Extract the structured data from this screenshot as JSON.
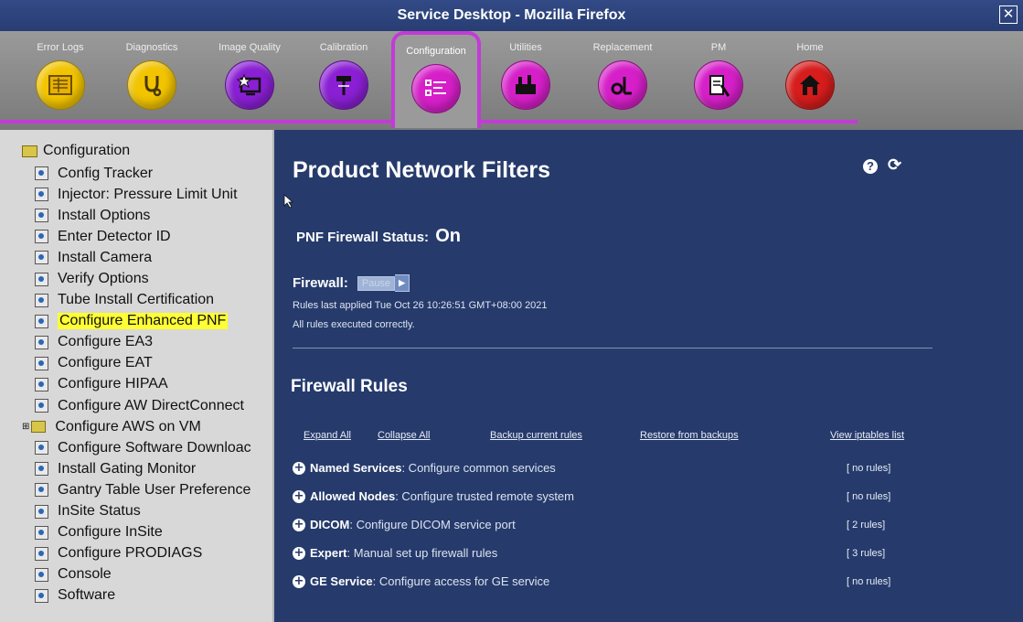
{
  "window": {
    "title": "Service Desktop - Mozilla Firefox",
    "close": "✕"
  },
  "toolbar": {
    "tabs": [
      {
        "label": "Error Logs",
        "icon": "log-icon",
        "color": "#f2c400"
      },
      {
        "label": "Diagnostics",
        "icon": "stethoscope-icon",
        "color": "#f2c400"
      },
      {
        "label": "Image Quality",
        "icon": "image-quality-icon",
        "color": "#8a1fd4"
      },
      {
        "label": "Calibration",
        "icon": "calibration-icon",
        "color": "#8a1fd4"
      },
      {
        "label": "Configuration",
        "icon": "checklist-icon",
        "color": "#d61fc8"
      },
      {
        "label": "Utilities",
        "icon": "toolbox-icon",
        "color": "#d61fc8"
      },
      {
        "label": "Replacement",
        "icon": "wrench-icon",
        "color": "#d61fc8"
      },
      {
        "label": "PM",
        "icon": "maintenance-icon",
        "color": "#d61fc8"
      },
      {
        "label": "Home",
        "icon": "home-icon",
        "color": "#d61c1c"
      }
    ],
    "active": "Configuration"
  },
  "tree": {
    "root": "Configuration",
    "items": [
      "Config Tracker",
      "Injector: Pressure Limit Unit",
      "Install Options",
      "Enter Detector ID",
      "Install Camera",
      "Verify Options",
      "Tube Install Certification",
      "Configure Enhanced PNF",
      "Configure EA3",
      "Configure EAT",
      "Configure HIPAA",
      "Configure AW DirectConnect",
      "Configure AWS on VM",
      "Configure Software Downloac",
      "Install Gating Monitor",
      "Gantry Table User Preference",
      "InSite Status",
      "Configure InSite",
      "Configure PRODIAGS",
      "Console",
      "Software"
    ],
    "selected": "Configure Enhanced PNF"
  },
  "main": {
    "title": "Product Network Filters",
    "help_icon": "?",
    "refresh_icon": "⟳",
    "pnf_label": "PNF Firewall Status:",
    "pnf_value": "On",
    "firewall_label": "Firewall:",
    "pause_label": "Pause",
    "play_label": "▶",
    "rules_applied": "Rules last applied Tue Oct 26 10:26:51 GMT+08:00 2021",
    "rules_status": "All rules executed correctly.",
    "section_title": "Firewall Rules",
    "links": {
      "expand": "Expand All",
      "collapse": "Collapse All",
      "backup": "Backup current rules",
      "restore": "Restore from backups",
      "view": "View iptables list"
    },
    "rules": [
      {
        "name": "Named Services",
        "desc": ": Configure common services",
        "count": "[ no rules]"
      },
      {
        "name": "Allowed Nodes",
        "desc": ": Configure trusted remote system",
        "count": "[ no rules]"
      },
      {
        "name": "DICOM",
        "desc": ": Configure DICOM service port",
        "count": "[ 2 rules]"
      },
      {
        "name": "Expert",
        "desc": ": Manual set up firewall rules",
        "count": "[ 3 rules]"
      },
      {
        "name": "GE Service",
        "desc": ": Configure access for GE service",
        "count": "[ no rules]"
      }
    ]
  }
}
